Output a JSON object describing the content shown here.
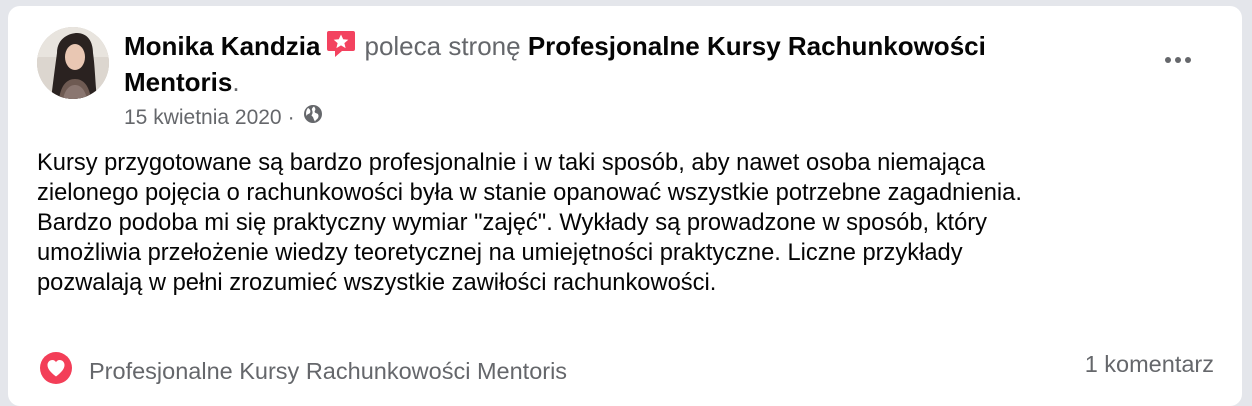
{
  "post": {
    "author": "Monika Kandzia",
    "verb": "poleca stronę",
    "page": "Profesjonalne Kursy Rachunkowości Mentoris",
    "period": ".",
    "date": "15 kwietnia 2020",
    "separator": "·",
    "privacy_icon": "globe-icon",
    "recommend_icon": "star-recommend-icon",
    "body_lines": [
      "Kursy przygotowane są bardzo profesjonalnie i w taki sposób, aby nawet osoba niemająca",
      "zielonego pojęcia o rachunkowości była w stanie opanować wszystkie potrzebne zagadnienia.",
      "Bardzo podoba mi się praktyczny wymiar \"zajęć\". Wykłady są prowadzone w sposób, który",
      "umożliwia przełożenie wiedzy teoretycznej na umiejętności praktyczne. Liczne przykłady",
      "pozwalają w pełni zrozumieć wszystkie zawiłości rachunkowości."
    ]
  },
  "footer": {
    "reaction_icon": "heart-icon",
    "reactor": "Profesjonalne Kursy Rachunkowości Mentoris",
    "comments": "1 komentarz"
  },
  "colors": {
    "recommend": "#f3425f",
    "heart": "#f33e58",
    "secondary_text": "#65676b",
    "primary_text": "#050505",
    "background": "#e4e6eb",
    "card": "#ffffff"
  }
}
